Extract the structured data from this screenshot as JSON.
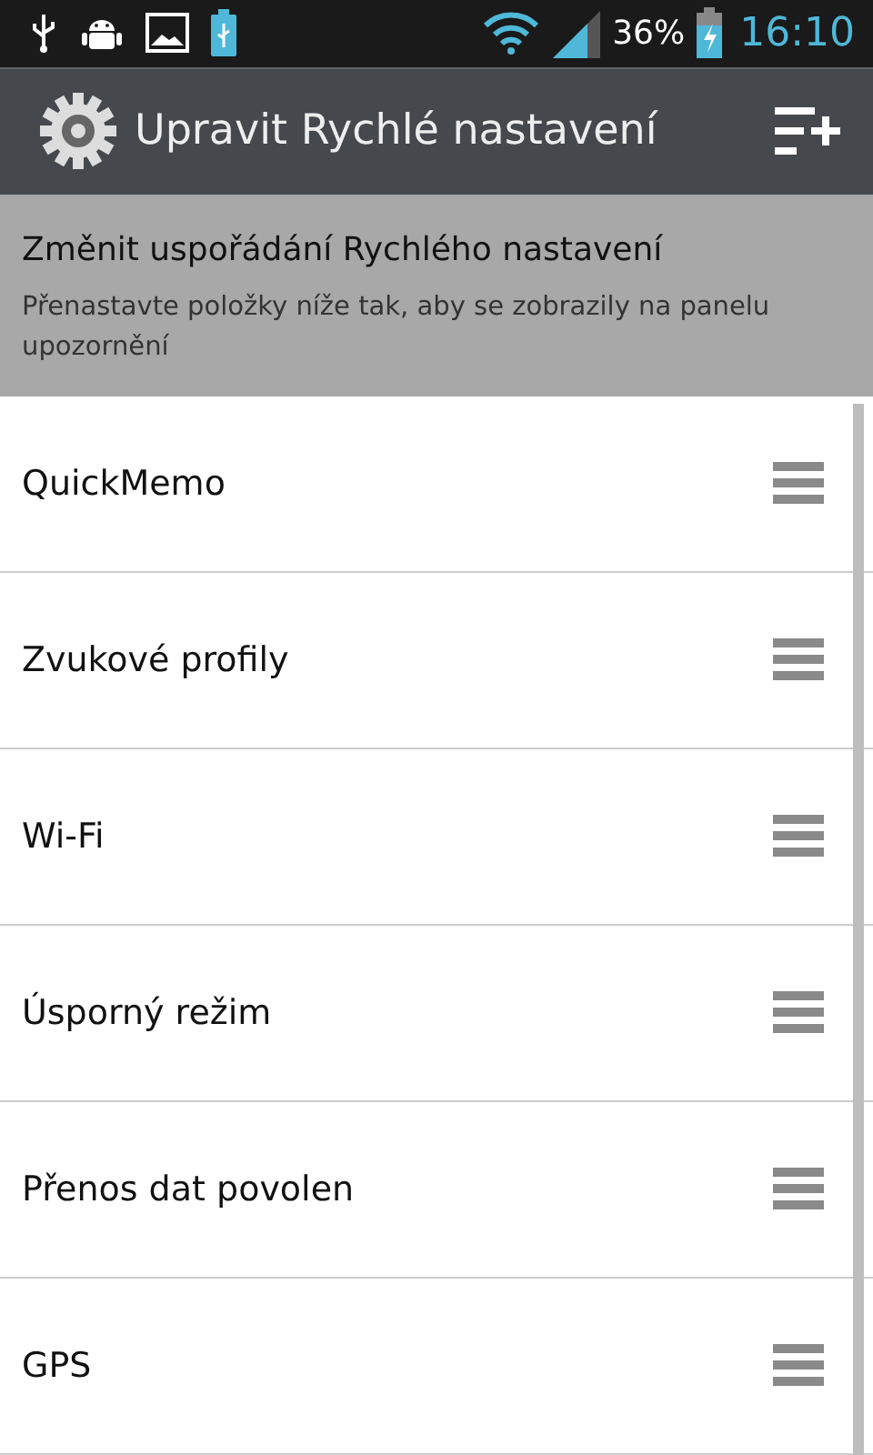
{
  "status_bar": {
    "battery_text": "36%",
    "time": "16:10"
  },
  "app_bar": {
    "title": "Upravit Rychlé nastavení"
  },
  "info": {
    "heading": "Změnit uspořádání Rychlého nastavení",
    "description": "Přenastavte položky níže tak, aby se zobrazily na panelu upozornění"
  },
  "items": [
    {
      "label": "QuickMemo"
    },
    {
      "label": "Zvukové profily"
    },
    {
      "label": "Wi-Fi"
    },
    {
      "label": "Úsporný režim"
    },
    {
      "label": "Přenos dat povolen"
    },
    {
      "label": "GPS"
    }
  ]
}
